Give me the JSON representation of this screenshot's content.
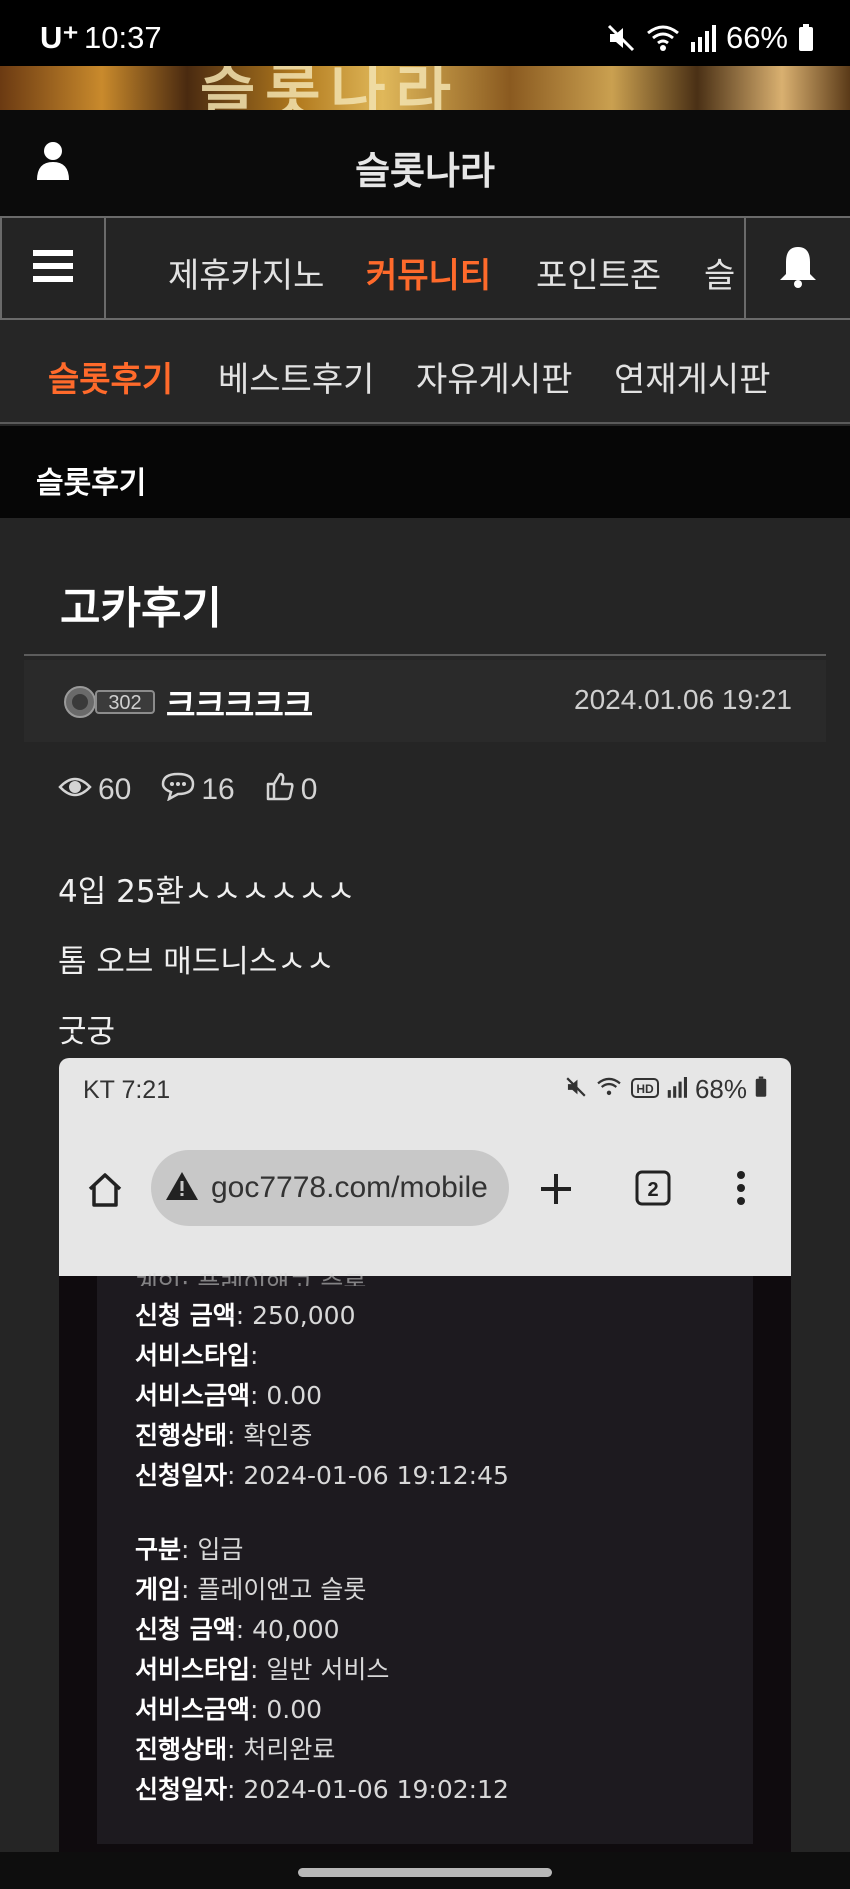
{
  "status_bar": {
    "carrier": "U⁺",
    "time": "10:37",
    "battery": "66%"
  },
  "banner": {
    "text": "슬롯나라"
  },
  "header": {
    "title": "슬롯나라"
  },
  "main_nav": {
    "items": [
      {
        "label": "제휴카지노"
      },
      {
        "label": "커뮤니티"
      },
      {
        "label": "포인트존"
      },
      {
        "label": "슬"
      }
    ],
    "active_index": 1
  },
  "sub_nav": {
    "items": [
      {
        "label": "슬롯후기"
      },
      {
        "label": "베스트후기"
      },
      {
        "label": "자유게시판"
      },
      {
        "label": "연재게시판"
      }
    ],
    "active_index": 0
  },
  "breadcrumb": {
    "label": "슬롯후기"
  },
  "post": {
    "title": "고카후기",
    "author_level": "302",
    "author": "크크크크크",
    "date": "2024.01.06 19:21",
    "views": "60",
    "comments": "16",
    "likes": "0",
    "body_lines": [
      "4입 25환ㅅㅅㅅㅅㅅㅅ",
      "톰 오브 매드니스ㅅㅅ",
      "굿궁"
    ]
  },
  "screenshot": {
    "carrier_time": "KT 7:21",
    "battery": "68%",
    "url": "goc7778.com/mobile",
    "tab_count": "2",
    "cut_off_row": "게임: 플레이앤고 슬롯",
    "card1": [
      {
        "label": "신청 금액",
        "value": ": 250,000"
      },
      {
        "label": "서비스타입",
        "value": ":"
      },
      {
        "label": "서비스금액",
        "value": ": 0.00"
      },
      {
        "label": "진행상태",
        "value": ": 확인중"
      },
      {
        "label": "신청일자",
        "value": ": 2024-01-06 19:12:45"
      }
    ],
    "card2": [
      {
        "label": "구분",
        "value": ": 입금"
      },
      {
        "label": "게임",
        "value": ": 플레이앤고 슬롯"
      },
      {
        "label": "신청 금액",
        "value": ": 40,000"
      },
      {
        "label": "서비스타입",
        "value": ": 일반 서비스"
      },
      {
        "label": "서비스금액",
        "value": ": 0.00"
      },
      {
        "label": "진행상태",
        "value": ": 처리완료"
      },
      {
        "label": "신청일자",
        "value": ": 2024-01-06 19:02:12"
      }
    ]
  },
  "colors": {
    "accent": "#ff6a2b",
    "background": "#252525"
  }
}
